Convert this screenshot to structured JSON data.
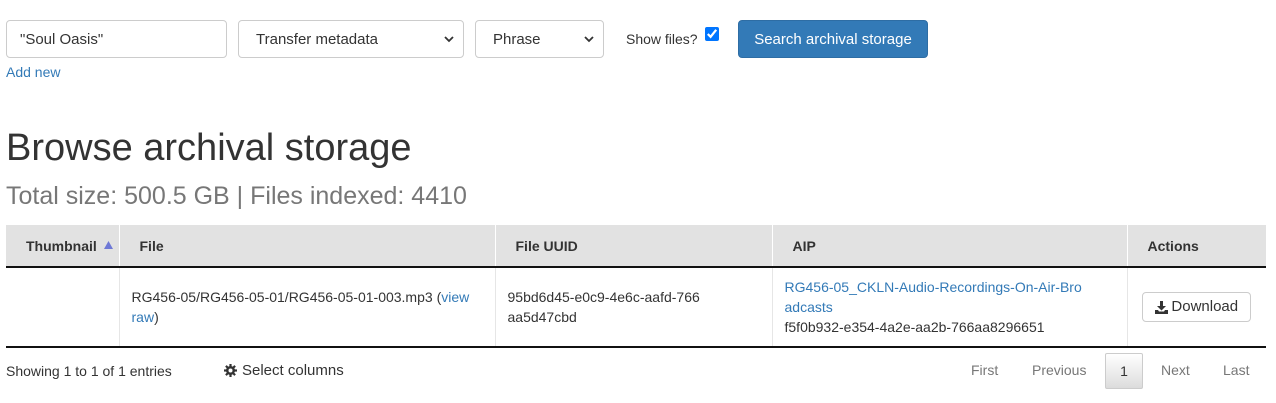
{
  "search": {
    "query_value": "\"Soul Oasis\"",
    "field_select": "Transfer metadata",
    "type_select": "Phrase",
    "show_files_label": "Show files?",
    "show_files_checked": true,
    "submit_label": "Search archival storage",
    "add_new_label": "Add new"
  },
  "page": {
    "title": "Browse archival storage",
    "subtitle": "Total size: 500.5 GB | Files indexed: 4410"
  },
  "table": {
    "columns": [
      "Thumbnail",
      "File",
      "File UUID",
      "AIP",
      "Actions"
    ],
    "rows": [
      {
        "thumbnail": "",
        "file_path": "RG456-05/RG456-05-01/RG456-05-01-003.mp3",
        "file_link_open": "(",
        "file_link_text": "view raw",
        "file_link_close": ")",
        "file_uuid": "95bd6d45-e0c9-4e6c-aafd-766aa5d47cbd",
        "aip_name": "RG456-05_CKLN-Audio-Recordings-On-Air-Broadcasts",
        "aip_uuid": "f5f0b932-e354-4a2e-aa2b-766aa8296651",
        "action_label": "Download"
      }
    ]
  },
  "footer": {
    "showing": "Showing 1 to 1 of 1 entries",
    "select_columns": "Select columns",
    "pagination": {
      "first": "First",
      "previous": "Previous",
      "current": "1",
      "next": "Next",
      "last": "Last"
    }
  },
  "colors": {
    "primary": "#337ab7",
    "header_bg": "#e2e2e2"
  },
  "icons": {
    "sort": "sort-asc-icon",
    "download": "download-icon",
    "columns": "gear-icon"
  }
}
